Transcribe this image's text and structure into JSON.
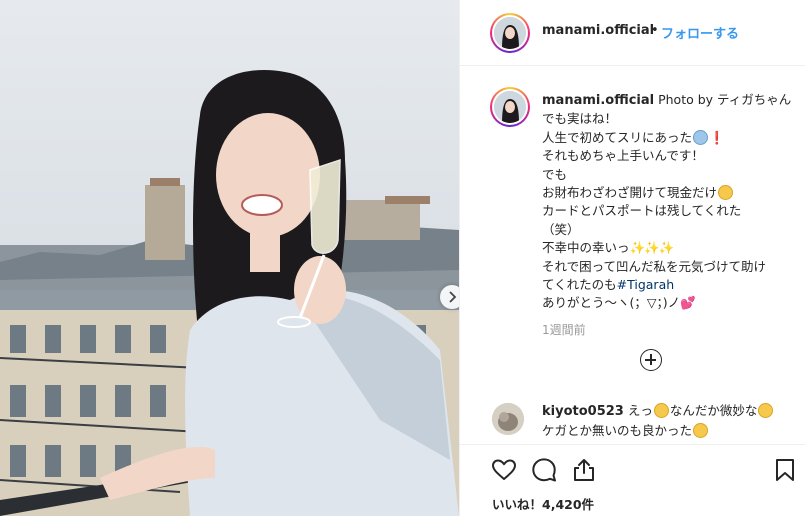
{
  "post": {
    "image_alt": "",
    "carousel_next_icon": "chevron-right-icon"
  },
  "header": {
    "avatar_icon": "profile-avatar-icon",
    "username": "manami.official",
    "separator": "•",
    "follow_label": "フォローする"
  },
  "caption": {
    "username": "manami.official",
    "photo_by": "Photo by ティガちゃん",
    "lines": [
      "でも実はね！",
      "人生で初めてスリにあった",
      "それもめちゃ上手いんです！",
      "でも",
      "お財布わざわざ開けて現金だけ",
      "カードとパスポートは残してくれた",
      "（笑）",
      "不幸中の幸いっ",
      "それで困って凹んだ私を元気づけて助け",
      "てくれたのも",
      "ありがとう〜ヽ(；▽；)ノ"
    ],
    "line_emoji": {
      "line_2": [
        "screaming-face-emoji",
        "exclamation-mark-emoji"
      ],
      "line_5": [
        "flushed-face-emoji"
      ],
      "line_8": [
        "sparkles-emoji",
        "sparkles-emoji",
        "sparkles-emoji"
      ],
      "line_11": [
        "heart-emoji"
      ]
    },
    "hashtag": "#Tigarah",
    "time_ago": "1週間前"
  },
  "load_more": {
    "icon": "plus-circle-icon"
  },
  "comment": {
    "username": "kiyoto0523",
    "part1": "えっ",
    "part2": "なんだか微妙な",
    "line2": "ケガとか無いのも良かった",
    "emoji": [
      "flushed-face-emoji",
      "grinning-sweat-emoji",
      "grinning-sweat-emoji"
    ]
  },
  "actions": {
    "like_icon": "heart-outline-icon",
    "comment_icon": "comment-bubble-icon",
    "share_icon": "share-icon",
    "save_icon": "bookmark-icon"
  },
  "likes_label": "いいね！4,420件",
  "colors": {
    "link_blue": "#3897f0",
    "hashtag_navy": "#003569",
    "text": "#262626",
    "muted": "#999999",
    "divider": "#efefef"
  }
}
